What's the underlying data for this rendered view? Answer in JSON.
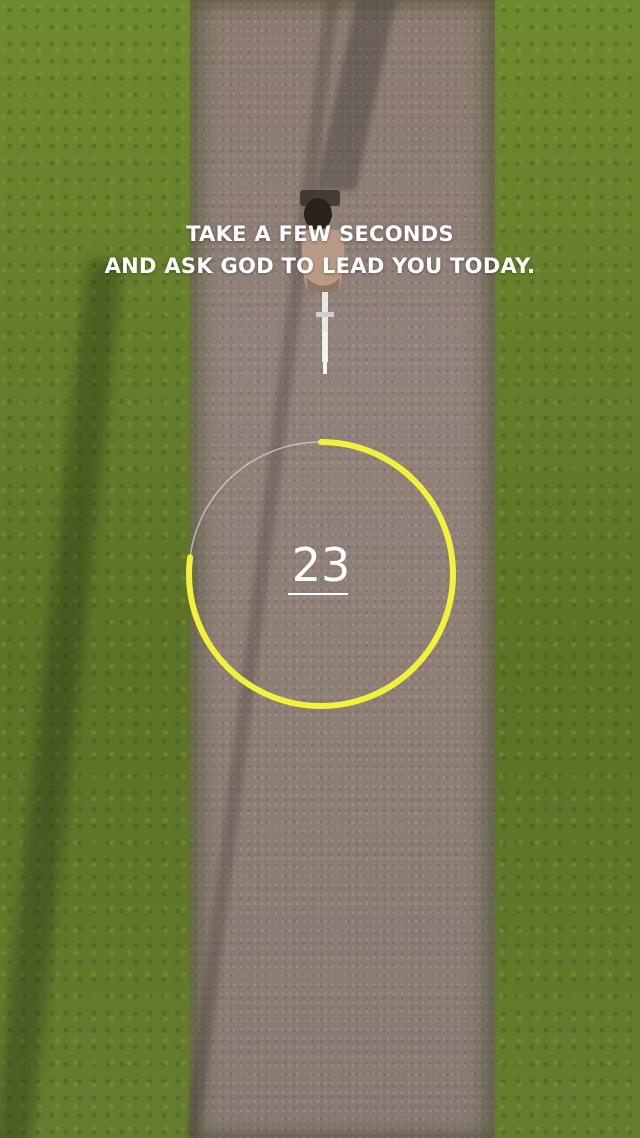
{
  "prompt": {
    "line1": "TAKE A FEW SECONDS",
    "line2": "AND ASK GOD TO LEAD YOU TODAY."
  },
  "timer": {
    "count": "23",
    "progress_fraction": 0.77,
    "ring_color": "#f2f23a",
    "track_color": "#d8d8d8"
  },
  "background": {
    "scene": "aerial view of cyclist on dirt path between grass"
  }
}
